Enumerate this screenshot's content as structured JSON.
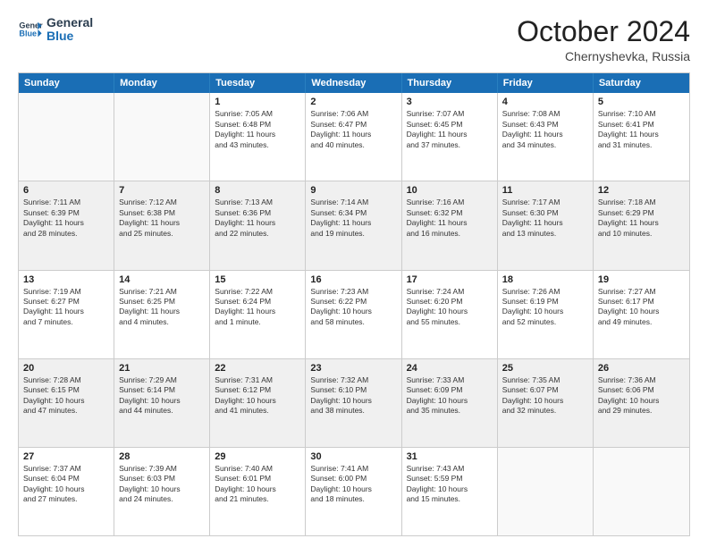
{
  "logo": {
    "line1": "General",
    "line2": "Blue"
  },
  "title": "October 2024",
  "location": "Chernyshevka, Russia",
  "days_of_week": [
    "Sunday",
    "Monday",
    "Tuesday",
    "Wednesday",
    "Thursday",
    "Friday",
    "Saturday"
  ],
  "weeks": [
    [
      {
        "num": "",
        "lines": []
      },
      {
        "num": "",
        "lines": []
      },
      {
        "num": "1",
        "lines": [
          "Sunrise: 7:05 AM",
          "Sunset: 6:48 PM",
          "Daylight: 11 hours",
          "and 43 minutes."
        ]
      },
      {
        "num": "2",
        "lines": [
          "Sunrise: 7:06 AM",
          "Sunset: 6:47 PM",
          "Daylight: 11 hours",
          "and 40 minutes."
        ]
      },
      {
        "num": "3",
        "lines": [
          "Sunrise: 7:07 AM",
          "Sunset: 6:45 PM",
          "Daylight: 11 hours",
          "and 37 minutes."
        ]
      },
      {
        "num": "4",
        "lines": [
          "Sunrise: 7:08 AM",
          "Sunset: 6:43 PM",
          "Daylight: 11 hours",
          "and 34 minutes."
        ]
      },
      {
        "num": "5",
        "lines": [
          "Sunrise: 7:10 AM",
          "Sunset: 6:41 PM",
          "Daylight: 11 hours",
          "and 31 minutes."
        ]
      }
    ],
    [
      {
        "num": "6",
        "lines": [
          "Sunrise: 7:11 AM",
          "Sunset: 6:39 PM",
          "Daylight: 11 hours",
          "and 28 minutes."
        ]
      },
      {
        "num": "7",
        "lines": [
          "Sunrise: 7:12 AM",
          "Sunset: 6:38 PM",
          "Daylight: 11 hours",
          "and 25 minutes."
        ]
      },
      {
        "num": "8",
        "lines": [
          "Sunrise: 7:13 AM",
          "Sunset: 6:36 PM",
          "Daylight: 11 hours",
          "and 22 minutes."
        ]
      },
      {
        "num": "9",
        "lines": [
          "Sunrise: 7:14 AM",
          "Sunset: 6:34 PM",
          "Daylight: 11 hours",
          "and 19 minutes."
        ]
      },
      {
        "num": "10",
        "lines": [
          "Sunrise: 7:16 AM",
          "Sunset: 6:32 PM",
          "Daylight: 11 hours",
          "and 16 minutes."
        ]
      },
      {
        "num": "11",
        "lines": [
          "Sunrise: 7:17 AM",
          "Sunset: 6:30 PM",
          "Daylight: 11 hours",
          "and 13 minutes."
        ]
      },
      {
        "num": "12",
        "lines": [
          "Sunrise: 7:18 AM",
          "Sunset: 6:29 PM",
          "Daylight: 11 hours",
          "and 10 minutes."
        ]
      }
    ],
    [
      {
        "num": "13",
        "lines": [
          "Sunrise: 7:19 AM",
          "Sunset: 6:27 PM",
          "Daylight: 11 hours",
          "and 7 minutes."
        ]
      },
      {
        "num": "14",
        "lines": [
          "Sunrise: 7:21 AM",
          "Sunset: 6:25 PM",
          "Daylight: 11 hours",
          "and 4 minutes."
        ]
      },
      {
        "num": "15",
        "lines": [
          "Sunrise: 7:22 AM",
          "Sunset: 6:24 PM",
          "Daylight: 11 hours",
          "and 1 minute."
        ]
      },
      {
        "num": "16",
        "lines": [
          "Sunrise: 7:23 AM",
          "Sunset: 6:22 PM",
          "Daylight: 10 hours",
          "and 58 minutes."
        ]
      },
      {
        "num": "17",
        "lines": [
          "Sunrise: 7:24 AM",
          "Sunset: 6:20 PM",
          "Daylight: 10 hours",
          "and 55 minutes."
        ]
      },
      {
        "num": "18",
        "lines": [
          "Sunrise: 7:26 AM",
          "Sunset: 6:19 PM",
          "Daylight: 10 hours",
          "and 52 minutes."
        ]
      },
      {
        "num": "19",
        "lines": [
          "Sunrise: 7:27 AM",
          "Sunset: 6:17 PM",
          "Daylight: 10 hours",
          "and 49 minutes."
        ]
      }
    ],
    [
      {
        "num": "20",
        "lines": [
          "Sunrise: 7:28 AM",
          "Sunset: 6:15 PM",
          "Daylight: 10 hours",
          "and 47 minutes."
        ]
      },
      {
        "num": "21",
        "lines": [
          "Sunrise: 7:29 AM",
          "Sunset: 6:14 PM",
          "Daylight: 10 hours",
          "and 44 minutes."
        ]
      },
      {
        "num": "22",
        "lines": [
          "Sunrise: 7:31 AM",
          "Sunset: 6:12 PM",
          "Daylight: 10 hours",
          "and 41 minutes."
        ]
      },
      {
        "num": "23",
        "lines": [
          "Sunrise: 7:32 AM",
          "Sunset: 6:10 PM",
          "Daylight: 10 hours",
          "and 38 minutes."
        ]
      },
      {
        "num": "24",
        "lines": [
          "Sunrise: 7:33 AM",
          "Sunset: 6:09 PM",
          "Daylight: 10 hours",
          "and 35 minutes."
        ]
      },
      {
        "num": "25",
        "lines": [
          "Sunrise: 7:35 AM",
          "Sunset: 6:07 PM",
          "Daylight: 10 hours",
          "and 32 minutes."
        ]
      },
      {
        "num": "26",
        "lines": [
          "Sunrise: 7:36 AM",
          "Sunset: 6:06 PM",
          "Daylight: 10 hours",
          "and 29 minutes."
        ]
      }
    ],
    [
      {
        "num": "27",
        "lines": [
          "Sunrise: 7:37 AM",
          "Sunset: 6:04 PM",
          "Daylight: 10 hours",
          "and 27 minutes."
        ]
      },
      {
        "num": "28",
        "lines": [
          "Sunrise: 7:39 AM",
          "Sunset: 6:03 PM",
          "Daylight: 10 hours",
          "and 24 minutes."
        ]
      },
      {
        "num": "29",
        "lines": [
          "Sunrise: 7:40 AM",
          "Sunset: 6:01 PM",
          "Daylight: 10 hours",
          "and 21 minutes."
        ]
      },
      {
        "num": "30",
        "lines": [
          "Sunrise: 7:41 AM",
          "Sunset: 6:00 PM",
          "Daylight: 10 hours",
          "and 18 minutes."
        ]
      },
      {
        "num": "31",
        "lines": [
          "Sunrise: 7:43 AM",
          "Sunset: 5:59 PM",
          "Daylight: 10 hours",
          "and 15 minutes."
        ]
      },
      {
        "num": "",
        "lines": []
      },
      {
        "num": "",
        "lines": []
      }
    ]
  ]
}
